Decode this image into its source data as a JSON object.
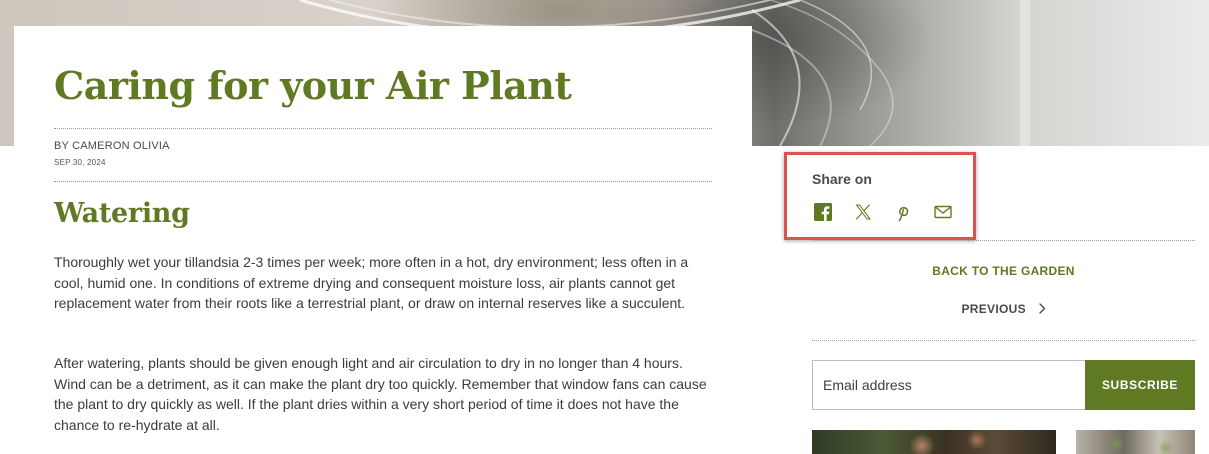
{
  "article": {
    "title": "Caring for your Air Plant",
    "byline": "BY CAMERON OLIVIA",
    "date": "SEP 30, 2024",
    "section_heading": "Watering",
    "paragraphs": [
      "Thoroughly wet your tillandsia 2-3 times per week; more often in a hot, dry environment; less often in a cool, humid one. In conditions of extreme drying and consequent moisture loss, air plants cannot get replacement water from their roots like a terrestrial plant, or draw on internal reserves like a succulent.",
      "After watering, plants should be given enough light and air circulation to dry in no longer than 4 hours. Wind can be a detriment, as it can make the plant dry too quickly. Remember that window fans can cause the plant to dry quickly as well. If the plant dries within a very short period of time it does not have the chance to re-hydrate at all."
    ]
  },
  "sidebar": {
    "share_label": "Share on",
    "share_icons": [
      "facebook-icon",
      "x-icon",
      "pinterest-icon",
      "mail-icon"
    ],
    "back_link": "BACK TO THE GARDEN",
    "previous_link": "PREVIOUS",
    "newsletter": {
      "placeholder": "Email address",
      "button_label": "SUBSCRIBE"
    }
  },
  "colors": {
    "accent_green": "#5f7a22",
    "highlight_border": "#d9534f"
  }
}
